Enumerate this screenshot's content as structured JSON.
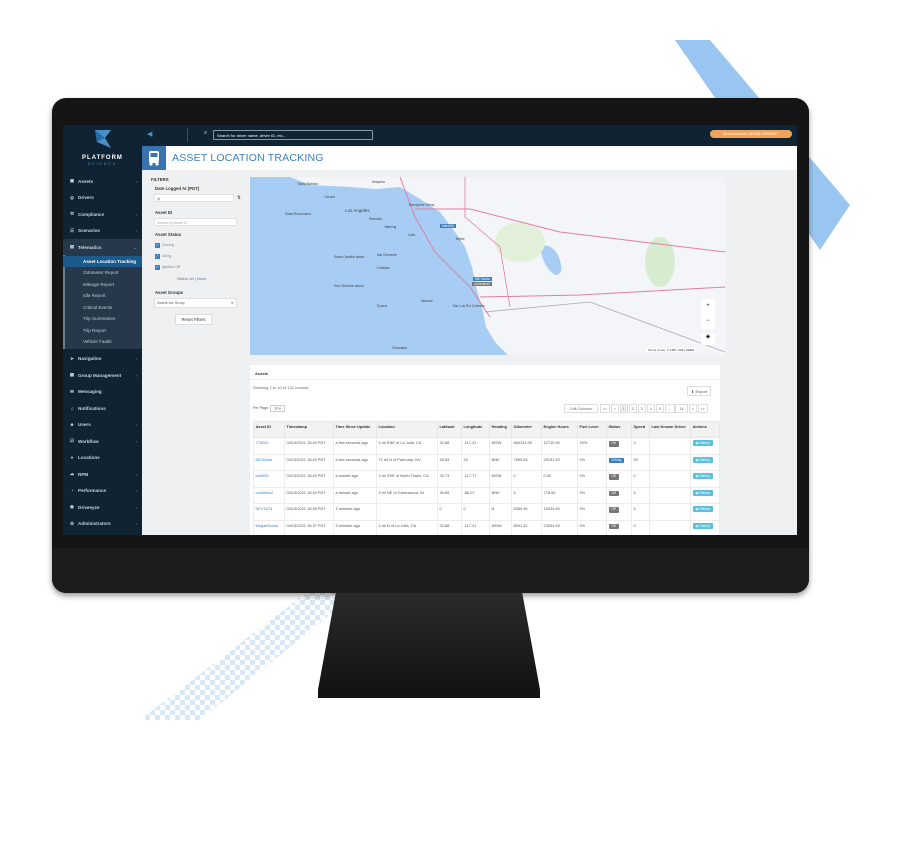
{
  "brand": {
    "name": "PLATFORM",
    "sub": "SCIENCE"
  },
  "sidebar": {
    "items": [
      {
        "label": "Assets",
        "icon": "truck-icon",
        "chevron": true
      },
      {
        "label": "Drivers",
        "icon": "steering-icon",
        "chevron": false
      },
      {
        "label": "Compliance",
        "icon": "gavel-icon",
        "chevron": true
      },
      {
        "label": "Scenarios",
        "icon": "list-icon",
        "chevron": true
      },
      {
        "label": "Telematics",
        "icon": "chart-icon",
        "chevron": true,
        "expanded": true
      },
      {
        "label": "Navigation",
        "icon": "nav-icon",
        "chevron": true
      },
      {
        "label": "Group Management",
        "icon": "grid-icon",
        "chevron": true
      },
      {
        "label": "Messaging",
        "icon": "chat-icon",
        "chevron": false
      },
      {
        "label": "Notifications",
        "icon": "bell-icon",
        "chevron": false
      },
      {
        "label": "Users",
        "icon": "users-icon",
        "chevron": true
      },
      {
        "label": "Workflow",
        "icon": "check-icon",
        "chevron": true
      },
      {
        "label": "Locations",
        "icon": "pin-icon",
        "chevron": false
      },
      {
        "label": "RPM",
        "icon": "cloud-icon",
        "chevron": true
      },
      {
        "label": "Performance",
        "icon": "gauge-icon",
        "chevron": true
      },
      {
        "label": "Driveeyze",
        "icon": "eye-icon",
        "chevron": true
      },
      {
        "label": "Administrators",
        "icon": "cogs-icon",
        "chevron": true
      }
    ],
    "telematics_sub": [
      "Asset Location Tracking",
      "Odometer Report",
      "Mileage Report",
      "Idle Report",
      "Critical Events",
      "Trip Summaries",
      "Trip Report",
      "Vehicle Faults"
    ]
  },
  "topbar": {
    "search_placeholder": "Search for driver name, driver ID, etc...",
    "environment": "Environment: DEVELOPMENT"
  },
  "page_title": "ASSET LOCATION TRACKING",
  "filters": {
    "heading": "FILTERS",
    "date_label": "Date Logged At (PDT)",
    "asset_id_label": "Asset ID",
    "asset_id_placeholder": "Search by Asset ID",
    "status_label": "Asset Status",
    "statuses": [
      {
        "label": "Driving",
        "checked": true
      },
      {
        "label": "Idling",
        "checked": true
      },
      {
        "label": "Ignition Off",
        "checked": true
      }
    ],
    "select_label": "Select:",
    "select_all": "All",
    "select_sep": "|",
    "select_none": "None",
    "groups_label": "Asset Groups",
    "groups_placeholder": "Search for Group",
    "reset": "Reset Filters"
  },
  "map": {
    "labels": [
      "Santa Barbara",
      "Oxnard",
      "Los Angeles",
      "Riverside",
      "Hesperia",
      "Twentynine Palms",
      "Santa Rosa Island",
      "San Clemente",
      "Carlsbad",
      "Santa Catalina Island",
      "San Clemente Island",
      "Tijuana",
      "Mexicali",
      "San Luis Río Colorado",
      "Ensenada",
      "Indio",
      "Banning",
      "Blythe"
    ],
    "markers": [
      "bde006",
      "cummins2",
      "6874Auto"
    ],
    "terms": "Terms of use",
    "copyright": "© 1987–2021 HERE",
    "zoom_in": "+",
    "zoom_out": "−"
  },
  "assets": {
    "heading": "Assets",
    "showing": "Showing 1 to 10 of 131 records",
    "export": "Export",
    "per_page_label": "Per Page:",
    "per_page": "10",
    "edit_columns": "Edit Columns",
    "pages": [
      "<<",
      "<",
      "1",
      "2",
      "3",
      "4",
      "5",
      "...",
      "14",
      ">",
      ">>"
    ],
    "current_page": "1",
    "columns": [
      "Asset ID",
      "Timestamp",
      "Time Since Update",
      "Location",
      "Latitude",
      "Longitude",
      "Heading",
      "Odometer",
      "Engine Hours",
      "Fuel Level",
      "Status",
      "Speed",
      "Last Known Driver",
      "Actions"
    ],
    "rows": [
      [
        "775202",
        "04/13/2021 15:40 PDT",
        "a few seconds ago",
        "4 mi ENE of La Jolla, CA",
        "32.88",
        "-117.21",
        "WSW",
        "460124.09",
        "12710.90",
        "20%",
        "Off",
        "0",
        "",
        "History"
      ],
      [
        "6874Auto",
        "04/13/2021 15:40 PDT",
        "a few seconds ago",
        "72 mi N of Pahrump, NV",
        "49.83",
        "24",
        "NNE",
        "7899.63",
        "29191.50",
        "0%",
        "Driving",
        "53",
        "",
        "History"
      ],
      [
        "bde005",
        "04/13/2021 15:40 PDT",
        "a minute ago",
        "3 mi SSE of North Tustin, CA",
        "33.73",
        "-117.77",
        "WSW",
        "0",
        "0.00",
        "0%",
        "Off",
        "0",
        "",
        "History"
      ],
      [
        "cummins2",
        "04/13/2021 15:40 PDT",
        "a minute ago",
        "3 mi NE of Greenwood, IN",
        "39.65",
        "-86.07",
        "NNE",
        "0",
        "778.65",
        "0%",
        "Off",
        "0",
        "",
        "History"
      ],
      [
        "DEV1874",
        "04/13/2021 15:39 PDT",
        "2 minutes ago",
        "",
        "0",
        "0",
        "N",
        "5360.49",
        "19244.90",
        "0%",
        "Off",
        "0",
        "",
        "History"
      ],
      [
        "MeganRocks",
        "04/13/2021 15:37 PDT",
        "3 minutes ago",
        "4 mi N of La Jolla, CA",
        "32.88",
        "-117.21",
        "WNW",
        "8531.42",
        "23294.45",
        "0%",
        "Off",
        "0",
        "",
        "History"
      ]
    ]
  },
  "colors": {
    "sidebar": "#0f2333",
    "accent": "#3a7ec0",
    "env": "#f0a35a",
    "off": "#777777",
    "driving": "#3a7ec0",
    "history": "#5bc0de"
  }
}
